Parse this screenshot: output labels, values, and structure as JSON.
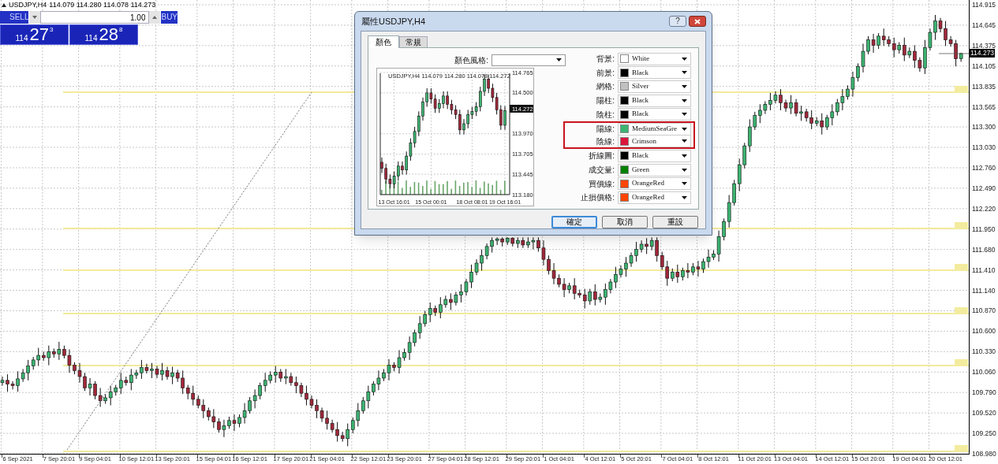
{
  "chart": {
    "header": {
      "symbol": "USDJPY,H4",
      "quotes": "114.079 114.280 114.078 114.273"
    },
    "chart_data": {
      "type": "candlestick",
      "grid": true,
      "ylim": [
        108.98,
        114.915
      ],
      "categories": [
        null,
        null,
        null,
        "6 Sep 2021",
        null,
        null,
        null,
        null,
        null,
        null,
        null,
        "7 Sep 20:01",
        null,
        null,
        null,
        null,
        null,
        null,
        "9 Sep 04:01",
        null,
        null,
        null,
        null,
        null,
        null,
        null,
        "10 Sep 12:01",
        null,
        null,
        null,
        null,
        null,
        null,
        "13 Sep 20:01",
        null,
        null,
        null,
        null,
        null,
        null,
        null,
        "15 Sep 04:01",
        null,
        null,
        null,
        null,
        null,
        null,
        "16 Sep 12:01",
        null,
        null,
        null,
        null,
        null,
        null,
        null,
        "17 Sep 20:01",
        null,
        null,
        null,
        null,
        null,
        null,
        "21 Sep 04:01",
        null,
        null,
        null,
        null,
        null,
        null,
        null,
        "22 Sep 12:01",
        null,
        null,
        null,
        null,
        null,
        null,
        "23 Sep 20:01",
        null,
        null,
        null,
        null,
        null,
        null,
        null,
        "27 Sep 04:01",
        null,
        null,
        null,
        null,
        null,
        null,
        "28 Sep 12:01",
        null,
        null,
        null,
        null,
        null,
        null,
        null,
        "29 Sep 20:01",
        null,
        null,
        null,
        null,
        null,
        null,
        "1 Oct 04:01",
        null,
        null,
        null,
        null,
        null,
        null,
        null,
        "4 Oct 12:01",
        null,
        null,
        null,
        null,
        null,
        null,
        "5 Oct 20:01",
        null,
        null,
        null,
        null,
        null,
        null,
        null,
        "7 Oct 04:01",
        null,
        null,
        null,
        null,
        null,
        null,
        "8 Oct 12:01",
        null,
        null,
        null,
        null,
        null,
        null,
        null,
        "11 Oct 20:01",
        null,
        null,
        null,
        null,
        null,
        null,
        "13 Oct 04:01",
        null,
        null,
        null,
        null,
        null,
        null,
        null,
        "14 Oct 12:01",
        null,
        null,
        null,
        null,
        null,
        null,
        "15 Oct 20:01",
        null,
        null,
        null,
        null,
        null,
        null,
        null,
        "19 Oct 04:01",
        null,
        null,
        null,
        null,
        null,
        null,
        "20 Oct 12:01",
        null,
        null,
        null
      ],
      "yticks": [
        {
          "value": 114.915,
          "label": "114.915"
        },
        {
          "value": 114.645,
          "label": "114.645"
        },
        {
          "value": 114.375,
          "label": "114.375"
        },
        {
          "value": 114.105,
          "label": "114.105"
        },
        {
          "value": 113.835,
          "label": "113.835"
        },
        {
          "value": 113.565,
          "label": "113.565"
        },
        {
          "value": 113.3,
          "label": "113.300"
        },
        {
          "value": 113.03,
          "label": "113.030"
        },
        {
          "value": 112.76,
          "label": "112.760"
        },
        {
          "value": 112.49,
          "label": "112.490"
        },
        {
          "value": 112.22,
          "label": "112.220"
        },
        {
          "value": 111.95,
          "label": "111.950"
        },
        {
          "value": 111.68,
          "label": "111.680"
        },
        {
          "value": 111.41,
          "label": "111.410"
        },
        {
          "value": 111.14,
          "label": "111.140"
        },
        {
          "value": 110.87,
          "label": "110.870"
        },
        {
          "value": 110.6,
          "label": "110.600"
        },
        {
          "value": 110.33,
          "label": "110.330"
        },
        {
          "value": 110.06,
          "label": "110.060"
        },
        {
          "value": 109.79,
          "label": "109.790"
        },
        {
          "value": 109.52,
          "label": "109.520"
        },
        {
          "value": 109.25,
          "label": "109.250"
        },
        {
          "value": 108.98,
          "label": "108.980"
        }
      ],
      "ohlc": [
        [
          109.92,
          110.0,
          109.88,
          109.95
        ],
        [
          109.95,
          110.03,
          109.8,
          109.9
        ],
        [
          109.9,
          109.94,
          109.83,
          109.88
        ],
        [
          109.88,
          110.07,
          109.8,
          109.97
        ],
        [
          109.97,
          110.1,
          109.93,
          110.05
        ],
        [
          110.05,
          110.22,
          109.95,
          110.14
        ],
        [
          110.14,
          110.26,
          110.09,
          110.22
        ],
        [
          110.22,
          110.38,
          110.14,
          110.28
        ],
        [
          110.28,
          110.33,
          110.21,
          110.25
        ],
        [
          110.25,
          110.41,
          110.15,
          110.33
        ],
        [
          110.33,
          110.37,
          110.25,
          110.3
        ],
        [
          110.3,
          110.46,
          110.22,
          110.36
        ],
        [
          110.36,
          110.41,
          110.24,
          110.28
        ],
        [
          110.28,
          110.36,
          110.05,
          110.15
        ],
        [
          110.15,
          110.19,
          110.03,
          110.08
        ],
        [
          110.08,
          110.18,
          109.92,
          110.0
        ],
        [
          110.0,
          110.05,
          109.81,
          109.85
        ],
        [
          109.85,
          109.98,
          109.75,
          109.9
        ],
        [
          109.9,
          109.94,
          109.7,
          109.75
        ],
        [
          109.75,
          109.85,
          109.6,
          109.68
        ],
        [
          109.68,
          109.77,
          109.64,
          109.72
        ],
        [
          109.72,
          109.88,
          109.62,
          109.8
        ],
        [
          109.8,
          109.89,
          109.75,
          109.85
        ],
        [
          109.85,
          110.05,
          109.77,
          109.95
        ],
        [
          109.95,
          110.0,
          109.88,
          109.92
        ],
        [
          109.92,
          110.1,
          109.82,
          110.02
        ],
        [
          110.02,
          110.09,
          109.97,
          110.05
        ],
        [
          110.05,
          110.22,
          109.97,
          110.12
        ],
        [
          110.12,
          110.17,
          110.04,
          110.08
        ],
        [
          110.08,
          110.18,
          109.98,
          110.1
        ],
        [
          110.1,
          110.14,
          109.98,
          110.03
        ],
        [
          110.03,
          110.18,
          109.95,
          110.08
        ],
        [
          110.08,
          110.13,
          109.96,
          110.0
        ],
        [
          110.0,
          110.13,
          109.9,
          110.05
        ],
        [
          110.05,
          110.09,
          109.93,
          109.98
        ],
        [
          109.98,
          110.08,
          109.77,
          109.85
        ],
        [
          109.85,
          109.89,
          109.7,
          109.78
        ],
        [
          109.78,
          109.88,
          109.62,
          109.7
        ],
        [
          109.7,
          109.75,
          109.58,
          109.62
        ],
        [
          109.62,
          109.7,
          109.45,
          109.55
        ],
        [
          109.55,
          109.59,
          109.42,
          109.47
        ],
        [
          109.47,
          109.57,
          109.32,
          109.4
        ],
        [
          109.4,
          109.45,
          109.26,
          109.3
        ],
        [
          109.3,
          109.43,
          109.2,
          109.35
        ],
        [
          109.35,
          109.47,
          109.31,
          109.42
        ],
        [
          109.42,
          109.5,
          109.28,
          109.38
        ],
        [
          109.38,
          109.5,
          109.33,
          109.46
        ],
        [
          109.46,
          109.65,
          109.38,
          109.55
        ],
        [
          109.55,
          109.73,
          109.51,
          109.68
        ],
        [
          109.68,
          109.83,
          109.58,
          109.75
        ],
        [
          109.75,
          109.92,
          109.7,
          109.88
        ],
        [
          109.88,
          110.05,
          109.8,
          109.95
        ],
        [
          109.95,
          110.07,
          109.91,
          110.02
        ],
        [
          110.02,
          110.14,
          109.92,
          110.06
        ],
        [
          110.06,
          110.1,
          109.93,
          109.98
        ],
        [
          109.98,
          110.1,
          109.9,
          110.0
        ],
        [
          110.0,
          110.05,
          109.88,
          109.92
        ],
        [
          109.92,
          110.0,
          109.78,
          109.88
        ],
        [
          109.88,
          109.92,
          109.73,
          109.78
        ],
        [
          109.78,
          109.88,
          109.62,
          109.7
        ],
        [
          109.7,
          109.75,
          109.58,
          109.62
        ],
        [
          109.62,
          109.7,
          109.45,
          109.55
        ],
        [
          109.55,
          109.59,
          109.4,
          109.45
        ],
        [
          109.45,
          109.55,
          109.3,
          109.38
        ],
        [
          109.38,
          109.43,
          109.26,
          109.3
        ],
        [
          109.3,
          109.4,
          109.14,
          109.22
        ],
        [
          109.22,
          109.27,
          109.14,
          109.18
        ],
        [
          109.18,
          109.38,
          109.08,
          109.3
        ],
        [
          109.3,
          109.46,
          109.25,
          109.42
        ],
        [
          109.42,
          109.65,
          109.34,
          109.55
        ],
        [
          109.55,
          109.73,
          109.51,
          109.68
        ],
        [
          109.68,
          109.88,
          109.58,
          109.8
        ],
        [
          109.8,
          109.94,
          109.75,
          109.9
        ],
        [
          109.9,
          110.08,
          109.82,
          109.98
        ],
        [
          109.98,
          110.1,
          109.94,
          110.05
        ],
        [
          110.05,
          110.23,
          109.95,
          110.15
        ],
        [
          110.15,
          110.19,
          110.07,
          110.12
        ],
        [
          110.12,
          110.35,
          110.04,
          110.25
        ],
        [
          110.25,
          110.37,
          110.21,
          110.32
        ],
        [
          110.32,
          110.53,
          110.22,
          110.45
        ],
        [
          110.45,
          110.62,
          110.4,
          110.58
        ],
        [
          110.58,
          110.8,
          110.5,
          110.7
        ],
        [
          110.7,
          110.87,
          110.66,
          110.82
        ],
        [
          110.82,
          110.98,
          110.72,
          110.9
        ],
        [
          110.9,
          110.94,
          110.8,
          110.85
        ],
        [
          110.85,
          111.05,
          110.77,
          110.95
        ],
        [
          110.95,
          111.07,
          110.91,
          111.02
        ],
        [
          111.02,
          111.1,
          110.88,
          110.98
        ],
        [
          110.98,
          111.12,
          110.94,
          111.08
        ],
        [
          111.08,
          111.22,
          110.98,
          111.12
        ],
        [
          111.12,
          111.29,
          111.07,
          111.25
        ],
        [
          111.25,
          111.48,
          111.17,
          111.38
        ],
        [
          111.38,
          111.55,
          111.34,
          111.5
        ],
        [
          111.5,
          111.68,
          111.4,
          111.6
        ],
        [
          111.6,
          111.76,
          111.55,
          111.72
        ],
        [
          111.72,
          111.84,
          111.64,
          111.8
        ],
        [
          111.8,
          111.84,
          111.74,
          111.82
        ],
        [
          111.82,
          111.84,
          111.72,
          111.78
        ],
        [
          111.78,
          111.84,
          111.74,
          111.83
        ],
        [
          111.83,
          111.84,
          111.72,
          111.76
        ],
        [
          111.76,
          111.84,
          111.7,
          111.8
        ],
        [
          111.8,
          111.84,
          111.7,
          111.74
        ],
        [
          111.74,
          111.84,
          111.7,
          111.78
        ],
        [
          111.78,
          111.84,
          111.68,
          111.8
        ],
        [
          111.8,
          111.84,
          111.65,
          111.7
        ],
        [
          111.7,
          111.8,
          111.47,
          111.55
        ],
        [
          111.55,
          111.6,
          111.35,
          111.4
        ],
        [
          111.4,
          111.5,
          111.22,
          111.3
        ],
        [
          111.3,
          111.35,
          111.18,
          111.22
        ],
        [
          111.22,
          111.3,
          111.05,
          111.15
        ],
        [
          111.15,
          111.24,
          111.1,
          111.2
        ],
        [
          111.2,
          111.3,
          111.02,
          111.1
        ],
        [
          111.1,
          111.15,
          111.04,
          111.08
        ],
        [
          111.08,
          111.16,
          110.9,
          111.0
        ],
        [
          111.0,
          111.16,
          110.95,
          111.12
        ],
        [
          111.12,
          111.22,
          110.94,
          111.02
        ],
        [
          111.02,
          111.1,
          110.98,
          111.05
        ],
        [
          111.05,
          111.23,
          110.95,
          111.15
        ],
        [
          111.15,
          111.29,
          111.1,
          111.25
        ],
        [
          111.25,
          111.45,
          111.17,
          111.35
        ],
        [
          111.35,
          111.47,
          111.31,
          111.42
        ],
        [
          111.42,
          111.58,
          111.32,
          111.5
        ],
        [
          111.5,
          111.64,
          111.45,
          111.6
        ],
        [
          111.6,
          111.78,
          111.52,
          111.68
        ],
        [
          111.68,
          111.8,
          111.64,
          111.75
        ],
        [
          111.75,
          111.83,
          111.62,
          111.72
        ],
        [
          111.72,
          111.84,
          111.67,
          111.8
        ],
        [
          111.8,
          111.84,
          111.52,
          111.6
        ],
        [
          111.6,
          111.65,
          111.41,
          111.45
        ],
        [
          111.45,
          111.53,
          111.2,
          111.3
        ],
        [
          111.3,
          111.43,
          111.26,
          111.38
        ],
        [
          111.38,
          111.48,
          111.24,
          111.32
        ],
        [
          111.32,
          111.44,
          111.27,
          111.4
        ],
        [
          111.4,
          111.5,
          111.3,
          111.38
        ],
        [
          111.38,
          111.5,
          111.34,
          111.45
        ],
        [
          111.45,
          111.53,
          111.32,
          111.42
        ],
        [
          111.42,
          111.56,
          111.37,
          111.52
        ],
        [
          111.52,
          111.68,
          111.44,
          111.58
        ],
        [
          111.58,
          111.67,
          111.54,
          111.62
        ],
        [
          111.62,
          111.93,
          111.52,
          111.85
        ],
        [
          111.85,
          112.09,
          111.8,
          112.05
        ],
        [
          112.05,
          112.4,
          111.97,
          112.3
        ],
        [
          112.3,
          112.6,
          112.26,
          112.55
        ],
        [
          112.55,
          112.88,
          112.45,
          112.8
        ],
        [
          112.8,
          113.09,
          112.75,
          113.05
        ],
        [
          113.05,
          113.4,
          112.97,
          113.3
        ],
        [
          113.3,
          113.5,
          113.26,
          113.45
        ],
        [
          113.45,
          113.6,
          113.35,
          113.52
        ],
        [
          113.52,
          113.64,
          113.47,
          113.6
        ],
        [
          113.6,
          113.75,
          113.52,
          113.65
        ],
        [
          113.65,
          113.77,
          113.61,
          113.72
        ],
        [
          113.72,
          113.8,
          113.52,
          113.62
        ],
        [
          113.62,
          113.66,
          113.5,
          113.55
        ],
        [
          113.55,
          113.72,
          113.47,
          113.62
        ],
        [
          113.62,
          113.67,
          113.44,
          113.48
        ],
        [
          113.48,
          113.58,
          113.38,
          113.5
        ],
        [
          113.5,
          113.54,
          113.37,
          113.42
        ],
        [
          113.42,
          113.52,
          113.27,
          113.35
        ],
        [
          113.35,
          113.43,
          113.31,
          113.38
        ],
        [
          113.38,
          113.48,
          113.2,
          113.3
        ],
        [
          113.3,
          113.46,
          113.26,
          113.42
        ],
        [
          113.42,
          113.6,
          113.32,
          113.5
        ],
        [
          113.5,
          113.67,
          113.45,
          113.62
        ],
        [
          113.62,
          113.8,
          113.52,
          113.7
        ],
        [
          113.7,
          113.85,
          113.66,
          113.8
        ],
        [
          113.8,
          114.03,
          113.7,
          113.95
        ],
        [
          113.95,
          114.14,
          113.9,
          114.1
        ],
        [
          114.1,
          114.4,
          114.02,
          114.3
        ],
        [
          114.3,
          114.5,
          114.26,
          114.45
        ],
        [
          114.45,
          114.53,
          114.28,
          114.38
        ],
        [
          114.38,
          114.54,
          114.33,
          114.5
        ],
        [
          114.5,
          114.6,
          114.37,
          114.45
        ],
        [
          114.45,
          114.5,
          114.36,
          114.4
        ],
        [
          114.4,
          114.48,
          114.22,
          114.32
        ],
        [
          114.32,
          114.42,
          114.27,
          114.38
        ],
        [
          114.38,
          114.48,
          114.17,
          114.25
        ],
        [
          114.25,
          114.35,
          114.21,
          114.3
        ],
        [
          114.3,
          114.38,
          114.08,
          114.18
        ],
        [
          114.18,
          114.22,
          114.03,
          114.08
        ],
        [
          114.08,
          114.45,
          114.0,
          114.35
        ],
        [
          114.35,
          114.6,
          114.31,
          114.55
        ],
        [
          114.55,
          114.78,
          114.45,
          114.7
        ],
        [
          114.7,
          114.74,
          114.55,
          114.6
        ],
        [
          114.6,
          114.7,
          114.37,
          114.45
        ],
        [
          114.45,
          114.5,
          114.36,
          114.4
        ],
        [
          114.4,
          114.45,
          114.1,
          114.2
        ],
        [
          114.2,
          114.28,
          114.16,
          114.27
        ]
      ]
    },
    "current_price": "114.273"
  },
  "trade_panel": {
    "sell": "SELL",
    "buy": "BUY",
    "lots": "1.00",
    "sell_price": {
      "prefix": "114",
      "main": "27",
      "suffix": "3"
    },
    "buy_price": {
      "prefix": "114",
      "main": "28",
      "suffix": "8"
    }
  },
  "dialog": {
    "title": "屬性USDJPY,H4",
    "help": "?",
    "tabs": [
      {
        "label": "顏色",
        "selected": true
      },
      {
        "label": "常規",
        "selected": false
      }
    ],
    "scheme_label": "顏色風格:",
    "preview": {
      "header": "USDJPY,H4  114.079 114.280 114.078 114.272",
      "current_price": "114.272",
      "chart_data": {
        "type": "candlestick",
        "grid": true,
        "ylim": [
          113.18,
          114.765
        ],
        "categories": [
          null,
          null,
          null,
          "13 Oct 16:01",
          null,
          null,
          null,
          null,
          null,
          null,
          null,
          null,
          "15 Oct 00:01",
          null,
          null,
          null,
          null,
          null,
          null,
          null,
          null,
          null,
          "18 Oct 08:01",
          null,
          null,
          null,
          null,
          null,
          null,
          null,
          "19 Oct 16:01"
        ],
        "yticks": [
          {
            "value": 114.765,
            "label": "114.765"
          },
          {
            "value": 114.5,
            "label": "114.500"
          },
          {
            "value": 113.97,
            "label": "113.970"
          },
          {
            "value": 113.705,
            "label": "113.705"
          },
          {
            "value": 113.445,
            "label": "113.445"
          },
          {
            "value": 113.18,
            "label": "113.180"
          }
        ],
        "ohlc": [
          [
            113.6,
            113.66,
            113.46,
            113.52
          ],
          [
            113.52,
            113.58,
            113.32,
            113.38
          ],
          [
            113.38,
            113.44,
            113.26,
            113.32
          ],
          [
            113.32,
            113.48,
            113.26,
            113.42
          ],
          [
            113.42,
            113.61,
            113.36,
            113.55
          ],
          [
            113.55,
            113.61,
            113.44,
            113.5
          ],
          [
            113.5,
            113.74,
            113.44,
            113.68
          ],
          [
            113.68,
            113.91,
            113.62,
            113.85
          ],
          [
            113.85,
            114.06,
            113.79,
            114.0
          ],
          [
            114.0,
            114.26,
            113.94,
            114.2
          ],
          [
            114.2,
            114.44,
            114.14,
            114.38
          ],
          [
            114.38,
            114.56,
            114.32,
            114.5
          ],
          [
            114.5,
            114.56,
            114.36,
            114.42
          ],
          [
            114.42,
            114.48,
            114.24,
            114.3
          ],
          [
            114.3,
            114.42,
            114.24,
            114.36
          ],
          [
            114.36,
            114.52,
            114.3,
            114.46
          ],
          [
            114.46,
            114.52,
            114.29,
            114.35
          ],
          [
            114.35,
            114.41,
            114.22,
            114.28
          ],
          [
            114.28,
            114.34,
            114.16,
            114.22
          ],
          [
            114.22,
            114.28,
            113.96,
            114.02
          ],
          [
            114.02,
            114.16,
            113.96,
            114.1
          ],
          [
            114.1,
            114.28,
            114.04,
            114.22
          ],
          [
            114.22,
            114.32,
            114.16,
            114.26
          ],
          [
            114.26,
            114.38,
            114.2,
            114.32
          ],
          [
            114.32,
            114.58,
            114.26,
            114.52
          ],
          [
            114.52,
            114.74,
            114.46,
            114.68
          ],
          [
            114.68,
            114.74,
            114.5,
            114.56
          ],
          [
            114.56,
            114.62,
            114.38,
            114.44
          ],
          [
            114.44,
            114.5,
            114.22,
            114.28
          ],
          [
            114.28,
            114.34,
            114.02,
            114.08
          ],
          [
            114.08,
            114.33,
            114.02,
            114.27
          ]
        ]
      }
    },
    "colors": [
      {
        "label": "背景:",
        "value": "White",
        "color": "#ffffff",
        "highlighted": false
      },
      {
        "label": "前景:",
        "value": "Black",
        "color": "#000000",
        "highlighted": false
      },
      {
        "label": "網格:",
        "value": "Silver",
        "color": "#c0c0c0",
        "highlighted": false
      },
      {
        "label": "陽柱:",
        "value": "Black",
        "color": "#000000",
        "highlighted": false
      },
      {
        "label": "陰柱:",
        "value": "Black",
        "color": "#000000",
        "highlighted": false
      },
      {
        "label": "陽線:",
        "value": "MediumSeaGre",
        "color": "#3cb371",
        "highlighted": true
      },
      {
        "label": "陰線:",
        "value": "Crimson",
        "color": "#dc143c",
        "highlighted": true
      },
      {
        "label": "折線圖:",
        "value": "Black",
        "color": "#000000",
        "highlighted": false
      },
      {
        "label": "成交量:",
        "value": "Green",
        "color": "#008000",
        "highlighted": false
      },
      {
        "label": "買價線:",
        "value": "OrangeRed",
        "color": "#ff4500",
        "highlighted": false
      },
      {
        "label": "止損價格:",
        "value": "OrangeRed",
        "color": "#ff4500",
        "highlighted": false
      }
    ],
    "buttons": [
      {
        "label": "確定",
        "default": true
      },
      {
        "label": "取消",
        "default": false
      },
      {
        "label": "重設",
        "default": false
      }
    ]
  }
}
